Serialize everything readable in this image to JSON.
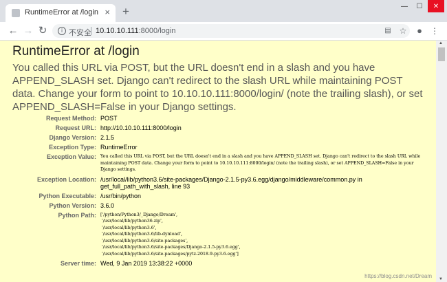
{
  "browser": {
    "tab_title": "RuntimeError at /login",
    "close_glyph": "×",
    "new_tab_glyph": "+",
    "not_secure": "不安全",
    "url_host": "10.10.10.111",
    "url_rest": ":8000/login",
    "window_controls": [
      "—",
      "☐",
      "✕"
    ]
  },
  "page": {
    "title": "RuntimeError at /login",
    "exception_value": "You called this URL via POST, but the URL doesn't end in a slash and you have APPEND_SLASH set. Django can't redirect to the slash URL while maintaining POST data. Change your form to point to 10.10.10.111:8000/login/ (note the trailing slash), or set APPEND_SLASH=False in your Django settings.",
    "meta": [
      {
        "label": "Request Method:",
        "value": "POST"
      },
      {
        "label": "Request URL:",
        "value": "http://10.10.10.111:8000/login"
      },
      {
        "label": "Django Version:",
        "value": "2.1.5"
      },
      {
        "label": "Exception Type:",
        "value": "RuntimeError"
      },
      {
        "label": "Exception Value:",
        "value": "You called this URL via POST, but the URL doesn't end in a slash and you have APPEND_SLASH set. Django can't redirect to the slash URL while maintaining POST data. Change your form to point to 10.10.10.111:8000/login/ (note the trailing slash), or set APPEND_SLASH=False in your Django settings."
      },
      {
        "label": "Exception Location:",
        "value": "/usr/local/lib/python3.6/site-packages/Django-2.1.5-py3.6.egg/django/middleware/common.py in get_full_path_with_slash, line 93"
      },
      {
        "label": "Python Executable:",
        "value": "/usr/bin/python"
      },
      {
        "label": "Python Version:",
        "value": "3.6.0"
      },
      {
        "label": "Python Path:",
        "value": "['/python/Python3/_Django/Dream',\n '/usr/local/lib/python36.zip',\n '/usr/local/lib/python3.6',\n '/usr/local/lib/python3.6/lib-dynload',\n '/usr/local/lib/python3.6/site-packages',\n '/usr/local/lib/python3.6/site-packages/Django-2.1.5-py3.6.egg',\n '/usr/local/lib/python3.6/site-packages/pytz-2018.9-py3.6.egg']"
      },
      {
        "label": "Server time:",
        "value": "Wed, 9 Jan 2019 13:38:22 +0000"
      }
    ]
  },
  "watermark": "https://blog.csdn.net/Dream"
}
